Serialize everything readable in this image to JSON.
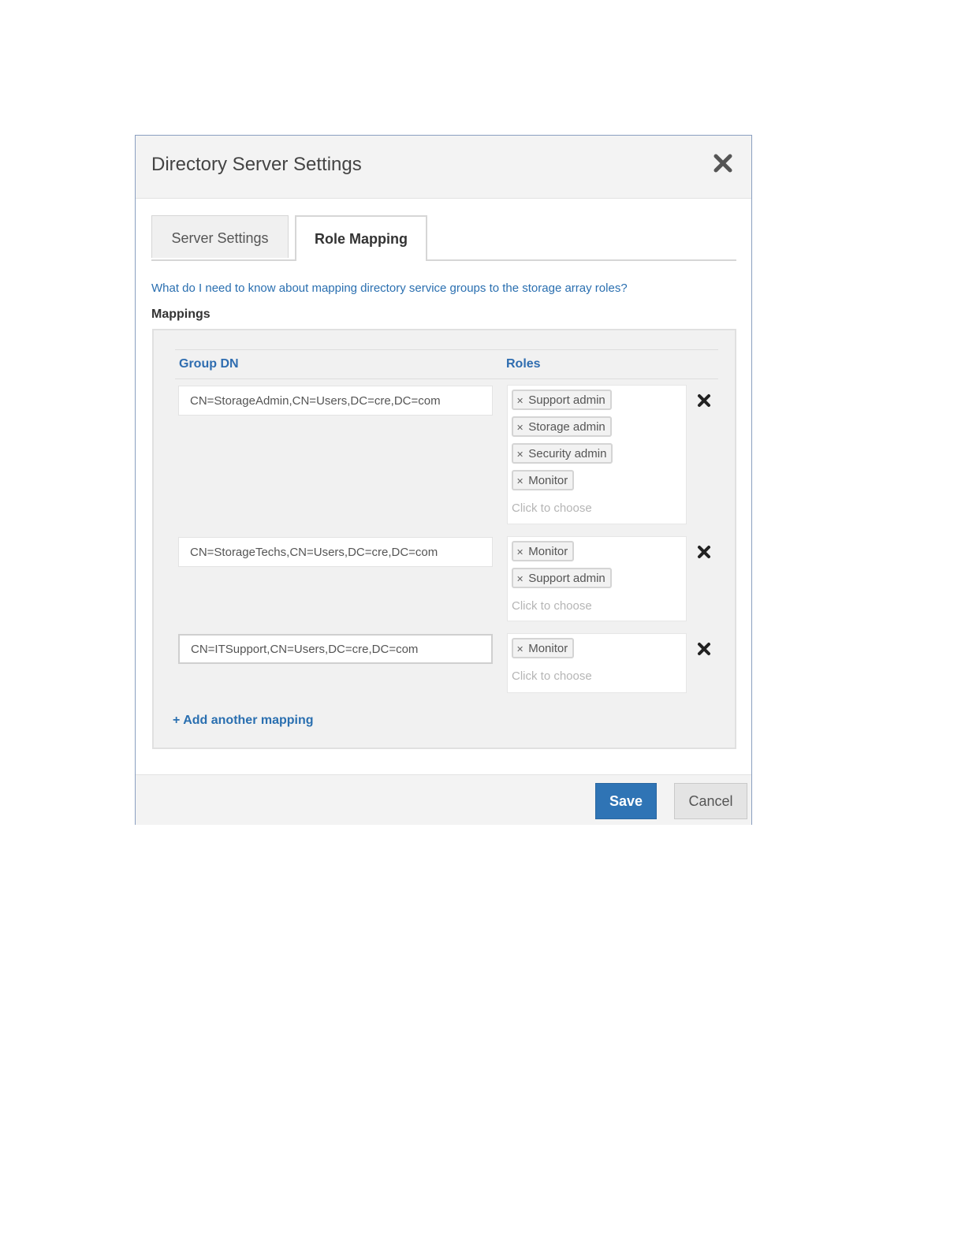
{
  "dialog": {
    "title": "Directory Server Settings",
    "close_icon": "close-icon"
  },
  "tabs": [
    {
      "label": "Server Settings",
      "active": false
    },
    {
      "label": "Role Mapping",
      "active": true
    }
  ],
  "help_link": "What do I need to know about mapping directory service groups to the storage array roles?",
  "mappings_label": "Mappings",
  "columns": {
    "group_dn": "Group DN",
    "roles": "Roles"
  },
  "mappings": [
    {
      "group_dn": "CN=StorageAdmin,CN=Users,DC=cre,DC=com",
      "roles": [
        "Support admin",
        "Storage admin",
        "Security admin",
        "Monitor"
      ],
      "placeholder": "Click to choose"
    },
    {
      "group_dn": "CN=StorageTechs,CN=Users,DC=cre,DC=com",
      "roles": [
        "Monitor",
        "Support admin"
      ],
      "placeholder": "Click to choose"
    },
    {
      "group_dn": "CN=ITSupport,CN=Users,DC=cre,DC=com",
      "roles": [
        "Monitor"
      ],
      "placeholder": "Click to choose",
      "focused": true
    }
  ],
  "add_mapping_label": "+ Add another mapping",
  "footer": {
    "save_label": "Save",
    "cancel_label": "Cancel"
  },
  "colors": {
    "accent": "#2f74b5",
    "link": "#2a6fb0",
    "header_text": "#2f6db0"
  }
}
